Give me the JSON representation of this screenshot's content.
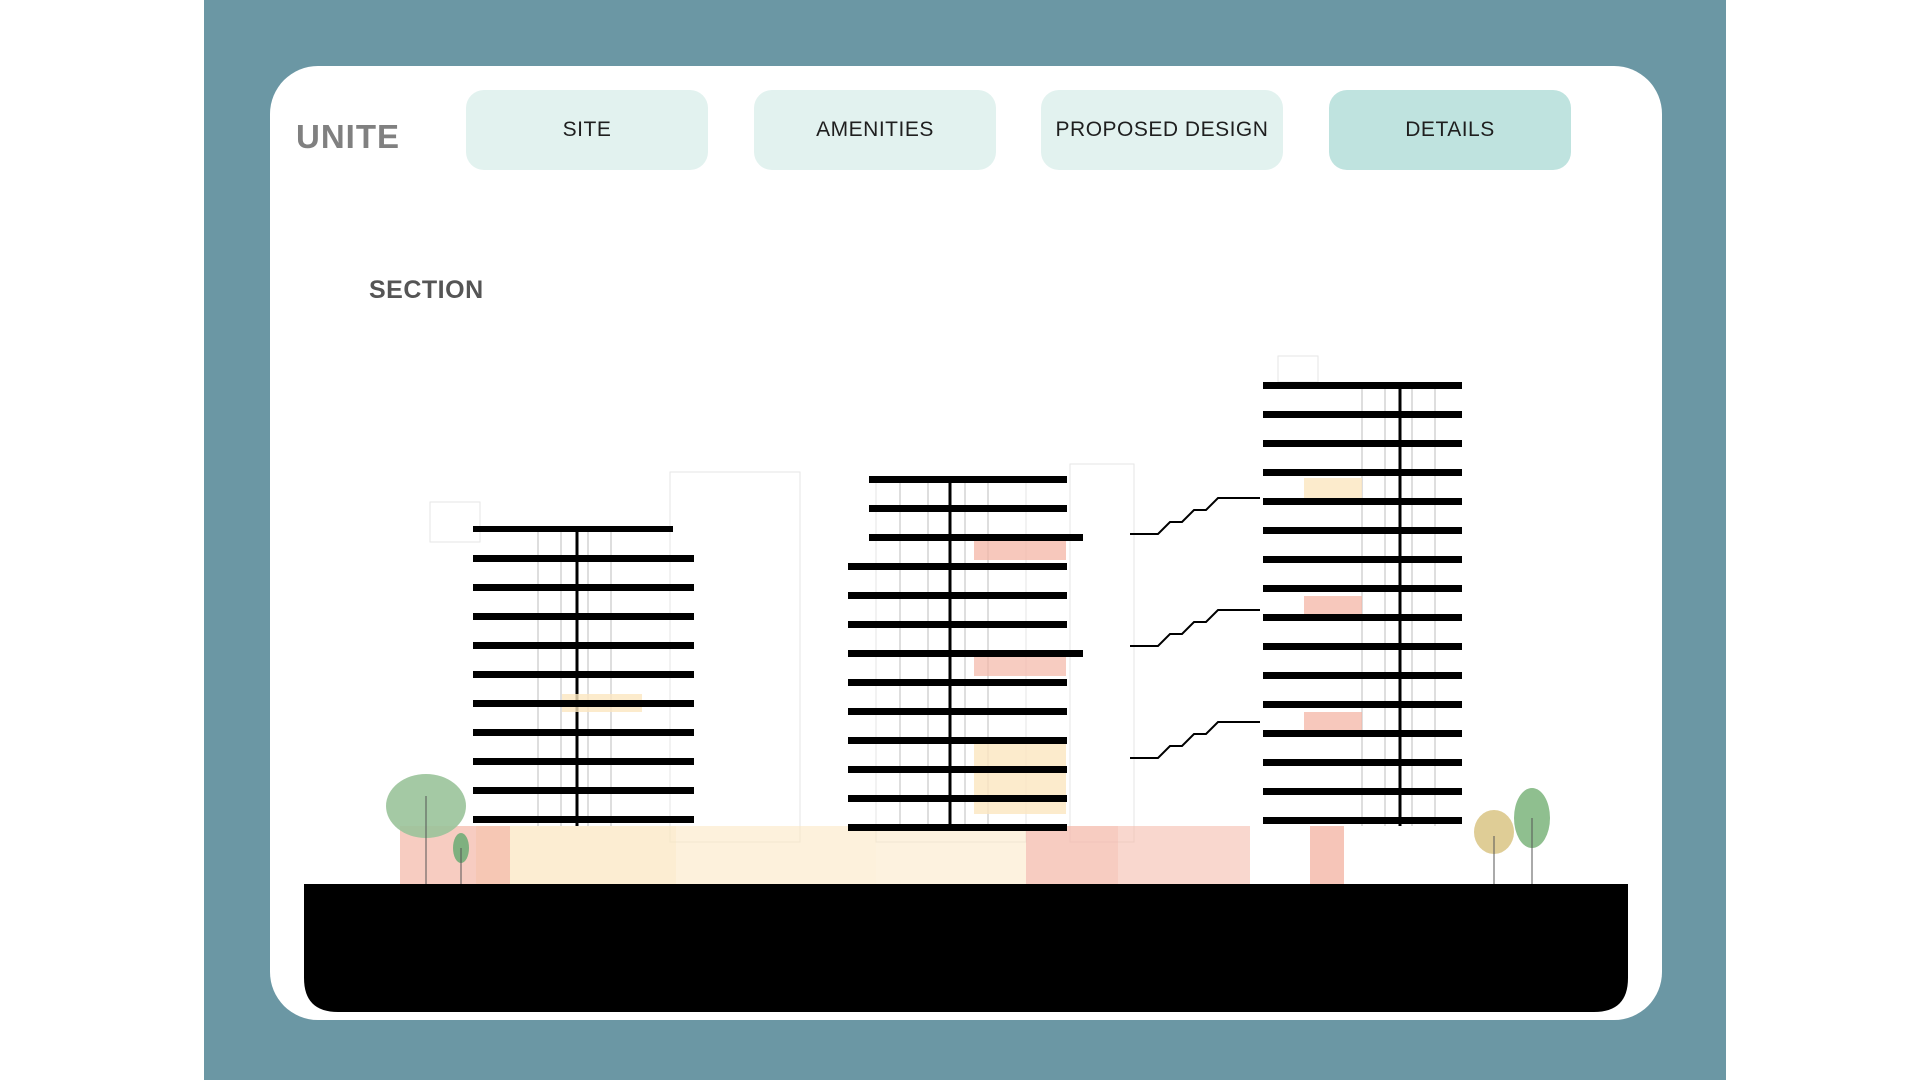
{
  "brand": {
    "name": "UNITE"
  },
  "nav": {
    "items": [
      {
        "label": "SITE"
      },
      {
        "label": "AMENITIES"
      },
      {
        "label": "PROPOSED DESIGN"
      },
      {
        "label": "DETAILS"
      }
    ],
    "active_label": "DETAILS"
  },
  "section": {
    "title": "SECTION"
  },
  "colors": {
    "frame": "#6b97a4",
    "card": "#ffffff",
    "nav_button": "#e2f2ef",
    "nav_button_active": "#bfe3df",
    "slab": "#000000",
    "ground": "#000000",
    "program_red": "#f4b6a6",
    "program_yellow": "#fbe6bf",
    "tree_green": "#9ac39a",
    "tree_yellow": "#dfcd96"
  }
}
